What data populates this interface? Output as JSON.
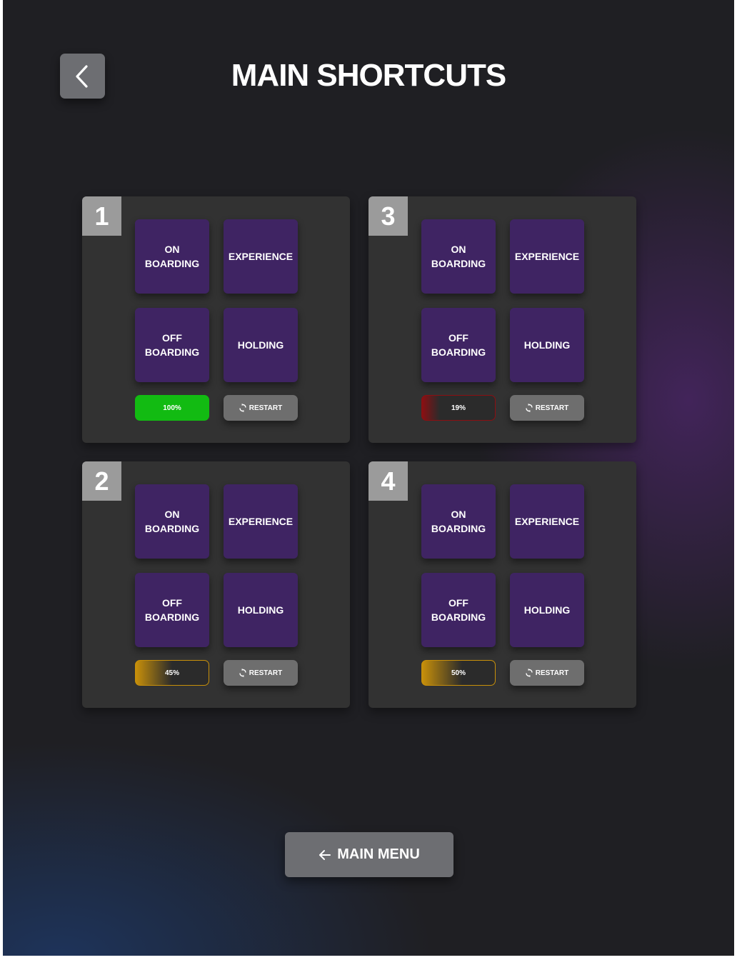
{
  "header": {
    "title": "MAIN SHORTCUTS",
    "back_icon": "chevron-left-icon"
  },
  "panels": [
    {
      "number": "1",
      "tiles": [
        "ON\nBOARDING",
        "EXPERIENCE",
        "OFF\nBOARDING",
        "HOLDING"
      ],
      "progress": {
        "label": "100%",
        "percent": 100,
        "color": "#12bb12",
        "style": "full"
      },
      "restart_label": "RESTART"
    },
    {
      "number": "3",
      "tiles": [
        "ON\nBOARDING",
        "EXPERIENCE",
        "OFF\nBOARDING",
        "HOLDING"
      ],
      "progress": {
        "label": "19%",
        "percent": 19,
        "color": "#8c0f12",
        "style": "partial"
      },
      "restart_label": "RESTART"
    },
    {
      "number": "2",
      "tiles": [
        "ON\nBOARDING",
        "EXPERIENCE",
        "OFF\nBOARDING",
        "HOLDING"
      ],
      "progress": {
        "label": "45%",
        "percent": 45,
        "color": "#c8900a",
        "style": "partial"
      },
      "restart_label": "RESTART"
    },
    {
      "number": "4",
      "tiles": [
        "ON\nBOARDING",
        "EXPERIENCE",
        "OFF\nBOARDING",
        "HOLDING"
      ],
      "progress": {
        "label": "50%",
        "percent": 50,
        "color": "#c8900a",
        "style": "partial"
      },
      "restart_label": "RESTART"
    }
  ],
  "footer": {
    "main_menu_label": "MAIN MENU",
    "main_menu_icon": "arrow-left-icon"
  },
  "colors": {
    "background": "#1f1f23",
    "panel": "#323232",
    "tile": "#3f2463",
    "badge": "#9b9b9b",
    "button_gray": "#6e6e6e"
  }
}
